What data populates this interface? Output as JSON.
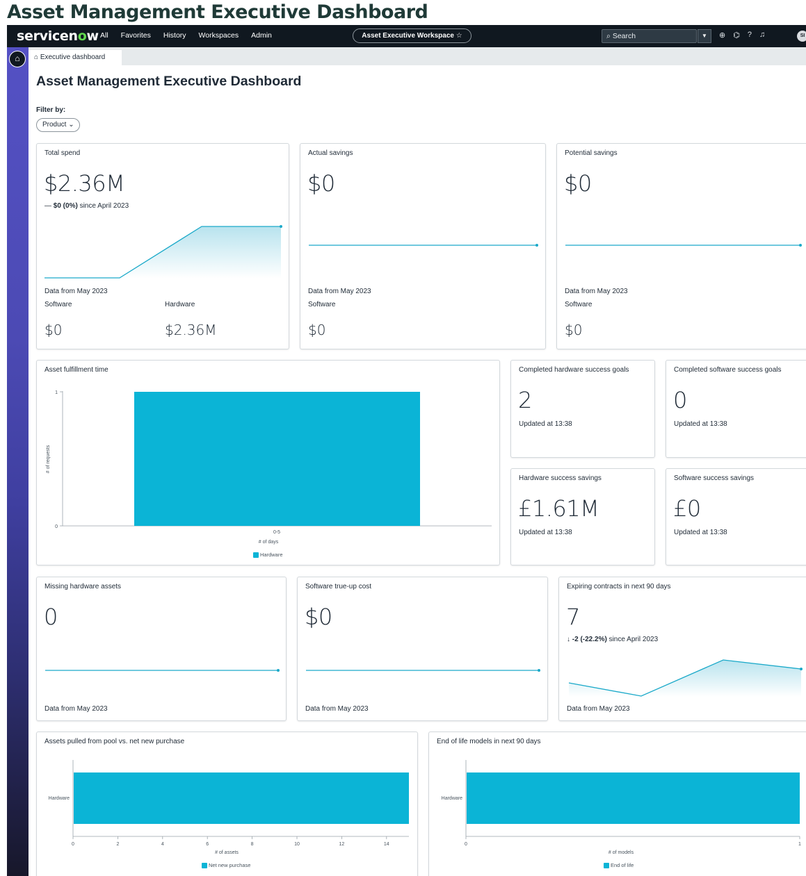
{
  "page_banner_title": "Asset Management Executive Dashboard",
  "navbar": {
    "logo_prefix": "servicen",
    "logo_o": "o",
    "logo_suffix": "w",
    "items": [
      "All",
      "Favorites",
      "History",
      "Workspaces",
      "Admin"
    ],
    "workspace_label": "Asset Executive Workspace ☆",
    "search_placeholder": "Search",
    "avatar_initials": "SI",
    "icons": [
      "globe-icon",
      "chat-icon",
      "help-icon",
      "bell-icon"
    ]
  },
  "tab": {
    "label": "Executive dashboard"
  },
  "page": {
    "title": "Asset Management Executive Dashboard",
    "filter_label": "Filter by:",
    "filter_value": "Product"
  },
  "colors": {
    "accent": "#0bb4d6",
    "line": "#1aa9c9",
    "navbar": "#101820",
    "sidebar_top": "#5451c4"
  },
  "cards": {
    "total_spend": {
      "title": "Total spend",
      "value": "$2.36M",
      "delta_value": "$0 (0%)",
      "delta_text": "since April 2023",
      "data_from": "Data from May 2023",
      "left_label": "Software",
      "left_value": "$0",
      "right_label": "Hardware",
      "right_value": "$2.36M"
    },
    "actual_savings": {
      "title": "Actual savings",
      "value": "$0",
      "data_from": "Data from May 2023",
      "left_label": "Software",
      "left_value": "$0"
    },
    "potential_savings": {
      "title": "Potential savings",
      "value": "$0",
      "data_from": "Data from May 2023",
      "left_label": "Software",
      "left_value": "$0"
    },
    "fulfillment": {
      "title": "Asset fulfillment time",
      "y_label": "# of requests",
      "x_label": "# of days",
      "y_ticks": [
        "1",
        "0"
      ],
      "x_tick": "0-5",
      "legend": "Hardware"
    },
    "hw_goals": {
      "title": "Completed hardware success goals",
      "value": "2",
      "updated": "Updated at 13:38"
    },
    "sw_goals": {
      "title": "Completed software success goals",
      "value": "0",
      "updated": "Updated at 13:38"
    },
    "hw_savings": {
      "title": "Hardware success savings",
      "value": "£1.61M",
      "updated": "Updated at 13:38"
    },
    "sw_savings": {
      "title": "Software success savings",
      "value": "£0",
      "updated": "Updated at 13:38"
    },
    "missing_hw": {
      "title": "Missing hardware assets",
      "value": "0",
      "data_from": "Data from May 2023"
    },
    "trueup": {
      "title": "Software true-up cost",
      "value": "$0",
      "data_from": "Data from May 2023"
    },
    "expiring": {
      "title": "Expiring contracts in next 90 days",
      "value": "7",
      "delta_value": "-2 (-22.2%)",
      "delta_text": "since April 2023",
      "data_from": "Data from May 2023"
    },
    "pool": {
      "title": "Assets pulled from pool vs. net new purchase",
      "category": "Hardware",
      "x_label": "# of assets",
      "x_ticks": [
        "0",
        "2",
        "4",
        "6",
        "8",
        "10",
        "12",
        "14"
      ],
      "legend": "Net new purchase"
    },
    "eol": {
      "title": "End of life models in next 90 days",
      "category": "Hardware",
      "x_label": "# of models",
      "x_ticks": [
        "0",
        "1"
      ],
      "legend": "End of life"
    }
  },
  "chart_data": [
    {
      "type": "bar",
      "categories": [
        "0-5"
      ],
      "series": [
        {
          "name": "Hardware",
          "values": [
            1
          ]
        }
      ],
      "xlabel": "# of days",
      "ylabel": "# of requests",
      "ylim": [
        0,
        1
      ]
    },
    {
      "type": "bar",
      "orientation": "horizontal",
      "categories": [
        "Hardware"
      ],
      "series": [
        {
          "name": "Net new purchase",
          "values": [
            15
          ]
        }
      ],
      "xlabel": "# of assets",
      "xlim": [
        0,
        15
      ]
    },
    {
      "type": "bar",
      "orientation": "horizontal",
      "categories": [
        "Hardware"
      ],
      "series": [
        {
          "name": "End of life",
          "values": [
            1
          ]
        }
      ],
      "xlabel": "# of models",
      "xlim": [
        0,
        1
      ]
    }
  ]
}
